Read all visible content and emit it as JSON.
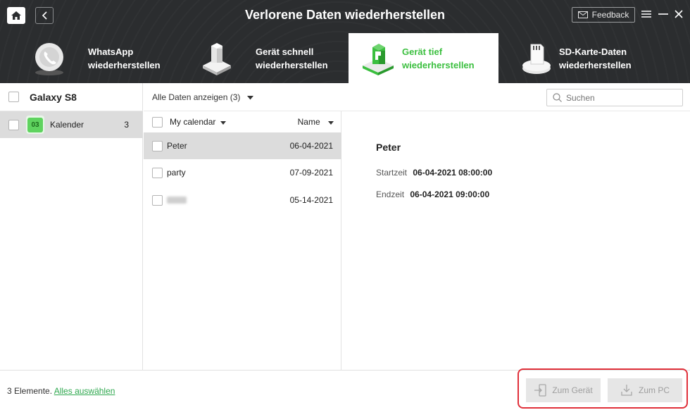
{
  "header": {
    "title": "Verlorene Daten wiederherstellen",
    "feedback_label": "Feedback",
    "tabs": [
      {
        "line1": "WhatsApp",
        "line2": "wiederherstellen"
      },
      {
        "line1": "Gerät schnell",
        "line2": "wiederherstellen"
      },
      {
        "line1": "Gerät tief",
        "line2": "wiederherstellen"
      },
      {
        "line1": "SD-Karte-Daten",
        "line2": "wiederherstellen"
      }
    ]
  },
  "sidebar": {
    "device": "Galaxy S8",
    "category": {
      "label": "Kalender",
      "count": "3",
      "icon_text": "03"
    }
  },
  "toolbar": {
    "filter": "Alle Daten anzeigen (3)",
    "search_placeholder": "Suchen"
  },
  "list": {
    "calendar_header": "My calendar",
    "name_header": "Name",
    "rows": [
      {
        "name": "Peter",
        "date": "06-04-2021"
      },
      {
        "name": "party",
        "date": "07-09-2021"
      },
      {
        "name": "",
        "date": "05-14-2021"
      }
    ]
  },
  "detail": {
    "title": "Peter",
    "start_key": "Startzeit",
    "start_val": "06-04-2021 08:00:00",
    "end_key": "Endzeit",
    "end_val": "06-04-2021 09:00:00"
  },
  "footer": {
    "count_text": "3 Elemente.",
    "select_all": "Alles auswählen",
    "to_device": "Zum Gerät",
    "to_pc": "Zum PC"
  },
  "colors": {
    "accent": "#3bbf3f",
    "header_bg": "#2b2d2f",
    "highlight_border": "#e0303a"
  }
}
